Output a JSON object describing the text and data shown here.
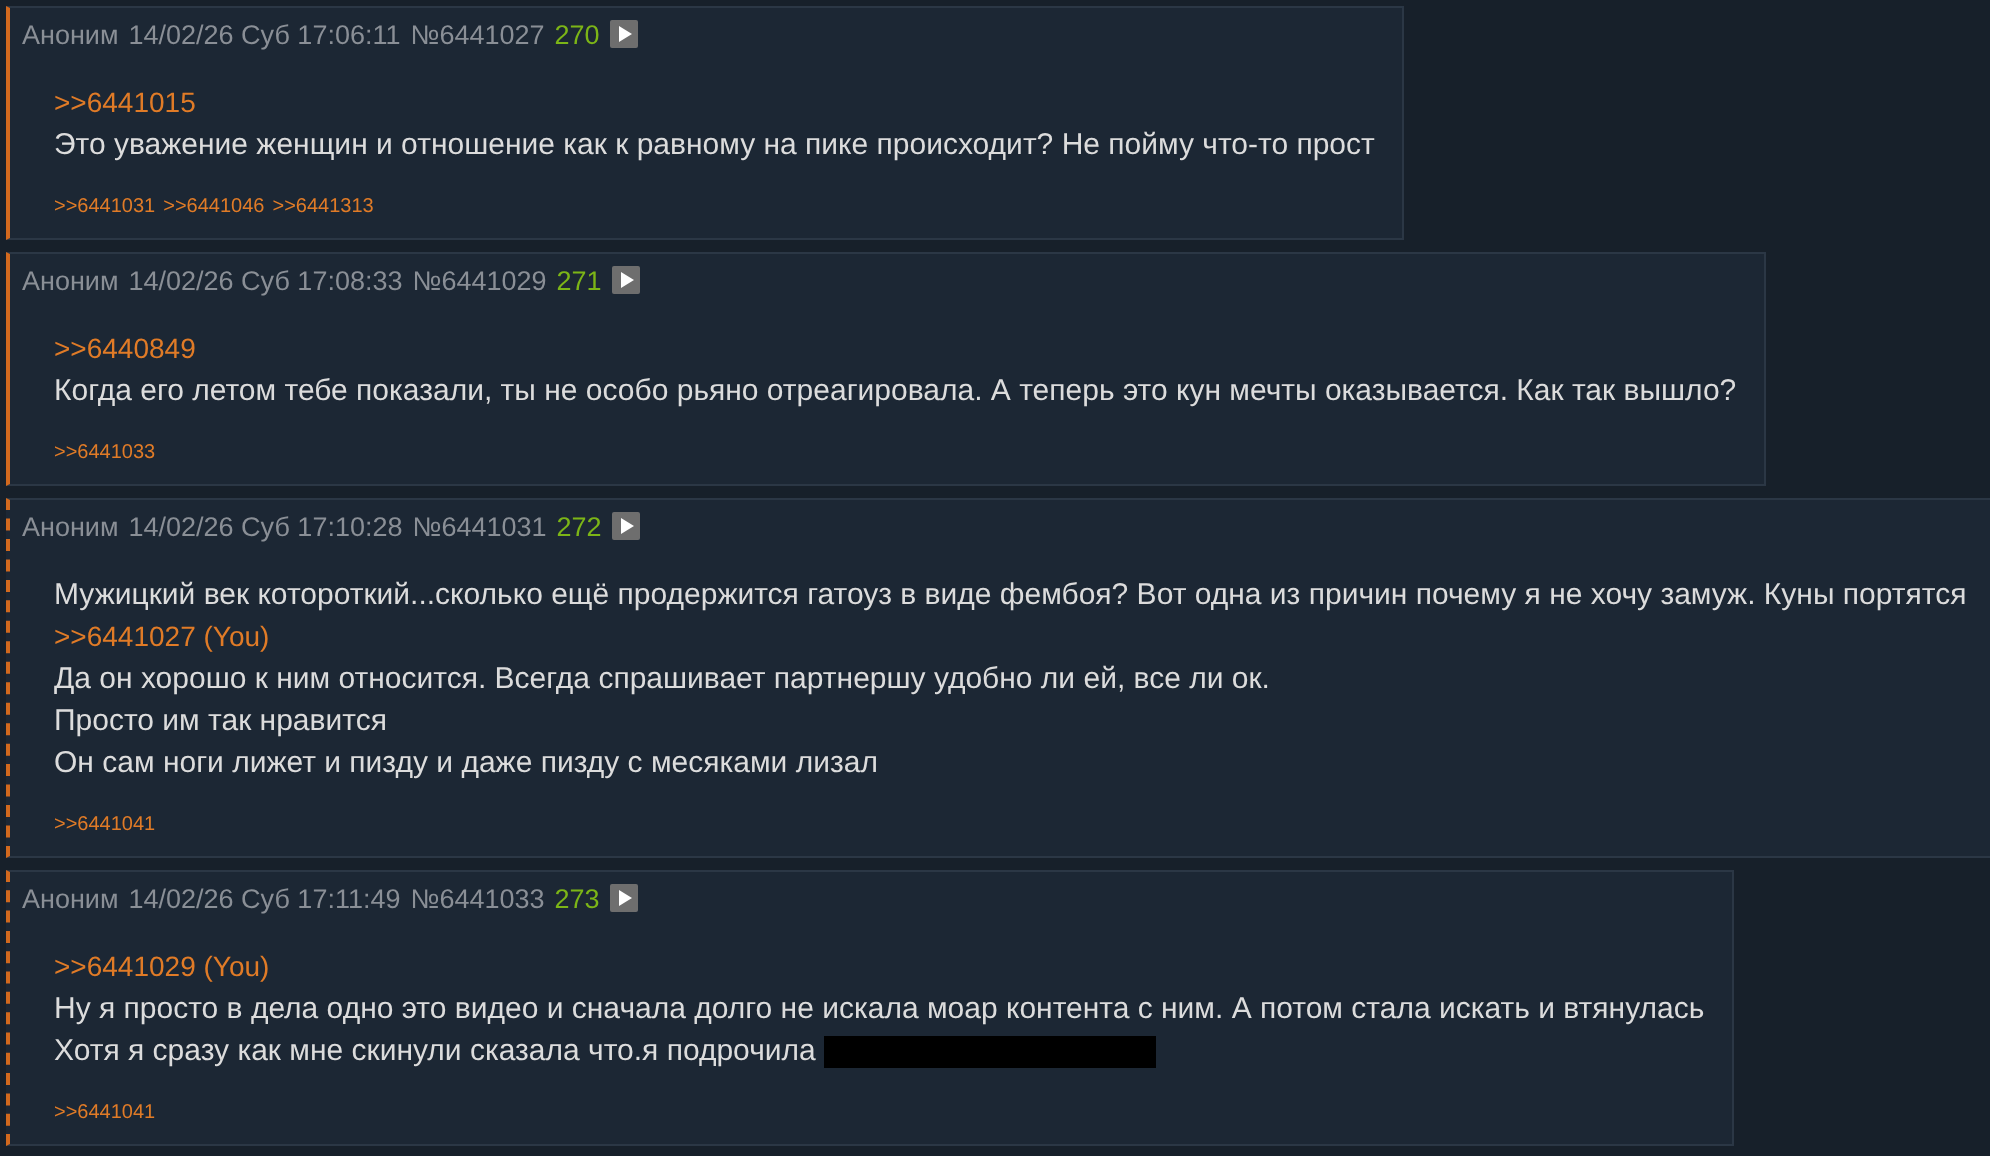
{
  "posts": [
    {
      "dashed_border": false,
      "name": "Аноним",
      "date": "14/02/26 Суб 17:06:11",
      "number": "№6441027",
      "count": "270",
      "lines": [
        {
          "kind": "reply",
          "text": ">>6441015"
        },
        {
          "kind": "text",
          "text": "Это уважение женщин и отношение как к равному на пике происходит? Не пойму что-то прост"
        }
      ],
      "replies": [
        ">>6441031",
        ">>6441046",
        ">>6441313"
      ]
    },
    {
      "dashed_border": false,
      "name": "Аноним",
      "date": "14/02/26 Суб 17:08:33",
      "number": "№6441029",
      "count": "271",
      "lines": [
        {
          "kind": "reply",
          "text": ">>6440849"
        },
        {
          "kind": "text",
          "text": "Когда его летом тебе показали, ты не особо рьяно отреагировала. А теперь это кун мечты оказывается. Как так вышло?"
        }
      ],
      "replies": [
        ">>6441033"
      ]
    },
    {
      "dashed_border": true,
      "name": "Аноним",
      "date": "14/02/26 Суб 17:10:28",
      "number": "№6441031",
      "count": "272",
      "lines": [
        {
          "kind": "text",
          "text": "Мужицкий век котороткий...сколько ещё продержится гатоуз в виде фембоя? Вот одна из причин почему я не хочу замуж. Куны портятся"
        },
        {
          "kind": "reply",
          "text": ">>6441027 (You)"
        },
        {
          "kind": "text",
          "text": "Да он хорошо к ним относится. Всегда спрашивает партнершу удобно ли ей, все ли ок."
        },
        {
          "kind": "text",
          "text": "Просто им так нравится"
        },
        {
          "kind": "text",
          "text": "Он сам ноги лижет и пизду и даже пизду с месяками лизал"
        }
      ],
      "replies": [
        ">>6441041"
      ]
    },
    {
      "dashed_border": true,
      "name": "Аноним",
      "date": "14/02/26 Суб 17:11:49",
      "number": "№6441033",
      "count": "273",
      "lines": [
        {
          "kind": "reply",
          "text": ">>6441029 (You)"
        },
        {
          "kind": "text",
          "text": "Ну я просто в дела одно это видео и сначала долго не искала моар контента с ним. А потом стала искать и втянулась"
        },
        {
          "kind": "text",
          "text": "Хотя я сразу как мне скинули сказала что.я подрочила",
          "spoiler": true
        }
      ],
      "replies": [
        ">>6441041"
      ]
    }
  ]
}
